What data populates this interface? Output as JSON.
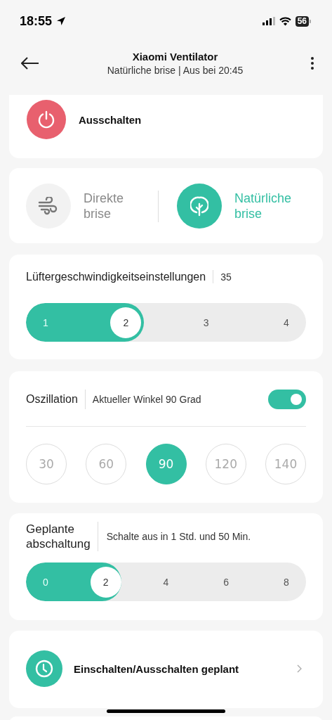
{
  "status_bar": {
    "time": "18:55",
    "battery": "56"
  },
  "header": {
    "title": "Xiaomi Ventilator",
    "subtitle": "Natürliche brise | Aus bei 20:45"
  },
  "power": {
    "label": "Ausschalten"
  },
  "modes": [
    {
      "kind": "direct",
      "label": "Direkte brise",
      "selected": false
    },
    {
      "kind": "natural",
      "label": "Natürliche brise",
      "selected": true
    }
  ],
  "fan_speed": {
    "title": "Lüftergeschwindigkeitseinstellungen",
    "value": "35",
    "level": 0.42,
    "steps": [
      {
        "label": "1",
        "selected": false
      },
      {
        "label": "2",
        "selected": true
      },
      {
        "label": "3",
        "selected": false
      },
      {
        "label": "4",
        "selected": false
      }
    ]
  },
  "oscillation": {
    "title": "Oszillation",
    "status": "Aktueller Winkel 90 Grad",
    "on": true,
    "angles": [
      {
        "label": "30",
        "selected": false
      },
      {
        "label": "60",
        "selected": false
      },
      {
        "label": "90",
        "selected": true
      },
      {
        "label": "120",
        "selected": false
      },
      {
        "label": "140",
        "selected": false
      }
    ]
  },
  "timer": {
    "title": "Geplante abschaltung",
    "status": "Schalte aus in 1 Std. und 50 Min.",
    "level": 0.34,
    "steps": [
      {
        "label": "0",
        "selected": false
      },
      {
        "label": "2",
        "selected": true
      },
      {
        "label": "4",
        "selected": false
      },
      {
        "label": "6",
        "selected": false
      },
      {
        "label": "8",
        "selected": false
      }
    ]
  },
  "schedule": {
    "label": "Einschalten/Ausschalten geplant"
  }
}
